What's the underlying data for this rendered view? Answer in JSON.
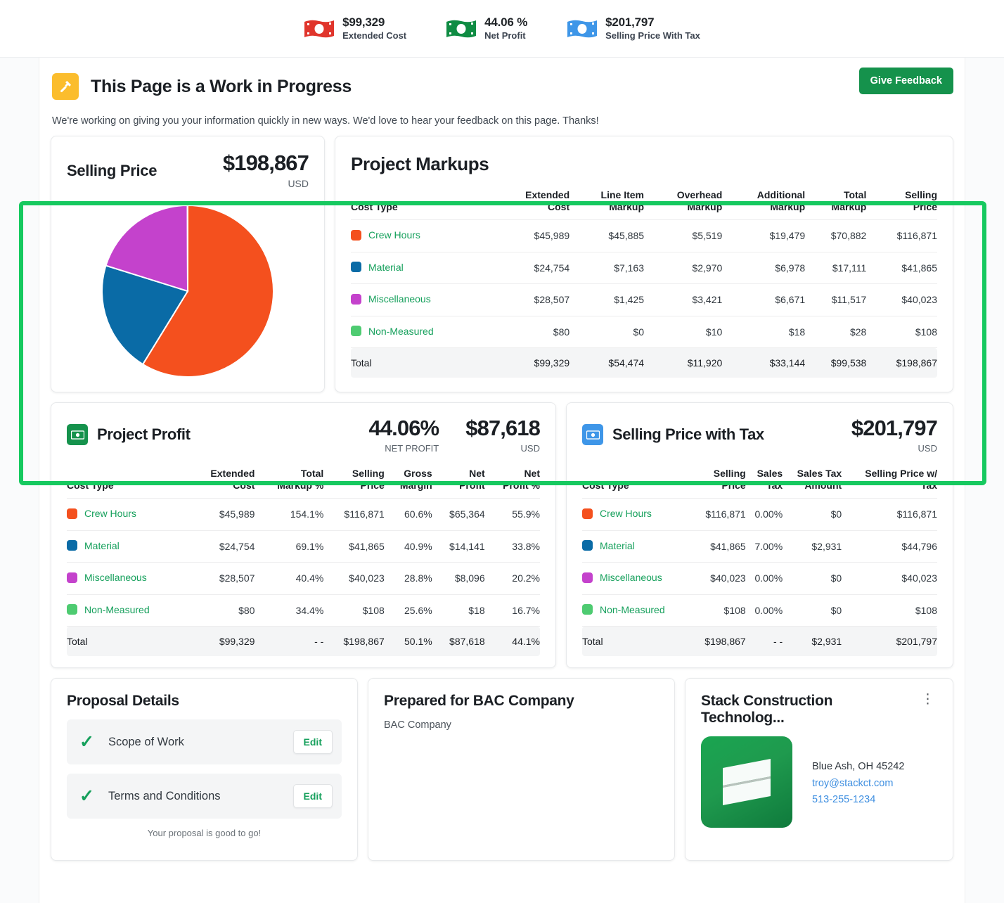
{
  "kpis": [
    {
      "icon": "money-bill-red-icon",
      "color": "#e0352c",
      "value": "$99,329",
      "label": "Extended Cost"
    },
    {
      "icon": "money-bill-green-icon",
      "color": "#0f8c43",
      "value": "44.06 %",
      "label": "Net Profit"
    },
    {
      "icon": "money-bill-blue-icon",
      "color": "#3e96e8",
      "value": "$201,797",
      "label": "Selling Price With Tax"
    }
  ],
  "banner": {
    "icon": "hammer-icon",
    "title": "This Page is a Work in Progress",
    "subtitle": "We're working on giving you your information quickly in new ways. We'd love to hear your feedback on this page. Thanks!",
    "button": "Give Feedback",
    "accent": "#15924c",
    "icon_bg": "#fbbd2d"
  },
  "highlight_color": "#16c95f",
  "selling_price": {
    "title": "Selling Price",
    "amount": "$198,867",
    "currency": "USD"
  },
  "chart_data": {
    "type": "pie",
    "title": "Selling Price",
    "categories": [
      "Crew Hours",
      "Material",
      "Miscellaneous",
      "Non-Measured"
    ],
    "values": [
      116871,
      41865,
      40023,
      108
    ],
    "percents": [
      58.77,
      21.05,
      20.13,
      0.05
    ],
    "colors": [
      "#f4501e",
      "#0a6ba6",
      "#c442cc",
      "#4ecb71"
    ],
    "total": 198867,
    "unit": "USD",
    "legend": "table",
    "grid": false
  },
  "markups": {
    "title": "Project Markups",
    "columns": [
      "Cost Type",
      "Extended\nCost",
      "Line Item\nMarkup",
      "Overhead\nMarkup",
      "Additional\nMarkup",
      "Total\nMarkup",
      "Selling\nPrice"
    ],
    "rows": [
      {
        "name": "Crew Hours",
        "color": "#f4501e",
        "cells": [
          "$45,989",
          "$45,885",
          "$5,519",
          "$19,479",
          "$70,882",
          "$116,871"
        ]
      },
      {
        "name": "Material",
        "color": "#0a6ba6",
        "cells": [
          "$24,754",
          "$7,163",
          "$2,970",
          "$6,978",
          "$17,111",
          "$41,865"
        ]
      },
      {
        "name": "Miscellaneous",
        "color": "#c442cc",
        "cells": [
          "$28,507",
          "$1,425",
          "$3,421",
          "$6,671",
          "$11,517",
          "$40,023"
        ]
      },
      {
        "name": "Non-Measured",
        "color": "#4ecb71",
        "cells": [
          "$80",
          "$0",
          "$10",
          "$18",
          "$28",
          "$108"
        ]
      }
    ],
    "total": {
      "name": "Total",
      "cells": [
        "$99,329",
        "$54,474",
        "$11,920",
        "$33,144",
        "$99,538",
        "$198,867"
      ]
    }
  },
  "profit": {
    "icon": "money-bill-green-square-icon",
    "icon_bg": "#15924c",
    "title": "Project Profit",
    "metrics": [
      {
        "value": "44.06%",
        "label": "NET PROFIT"
      },
      {
        "value": "$87,618",
        "label": "USD"
      }
    ],
    "columns": [
      "Cost Type",
      "Extended\nCost",
      "Total\nMarkup %",
      "Selling\nPrice",
      "Gross\nMargin",
      "Net\nProfit",
      "Net\nProfit %"
    ],
    "rows": [
      {
        "name": "Crew Hours",
        "color": "#f4501e",
        "cells": [
          "$45,989",
          "154.1%",
          "$116,871",
          "60.6%",
          "$65,364",
          "55.9%"
        ]
      },
      {
        "name": "Material",
        "color": "#0a6ba6",
        "cells": [
          "$24,754",
          "69.1%",
          "$41,865",
          "40.9%",
          "$14,141",
          "33.8%"
        ]
      },
      {
        "name": "Miscellaneous",
        "color": "#c442cc",
        "cells": [
          "$28,507",
          "40.4%",
          "$40,023",
          "28.8%",
          "$8,096",
          "20.2%"
        ]
      },
      {
        "name": "Non-Measured",
        "color": "#4ecb71",
        "cells": [
          "$80",
          "34.4%",
          "$108",
          "25.6%",
          "$18",
          "16.7%"
        ]
      }
    ],
    "total": {
      "name": "Total",
      "cells": [
        "$99,329",
        "- -",
        "$198,867",
        "50.1%",
        "$87,618",
        "44.1%"
      ]
    }
  },
  "tax": {
    "icon": "money-bill-blue-square-icon",
    "icon_bg": "#3e96e8",
    "title": "Selling Price with Tax",
    "metrics": [
      {
        "value": "$201,797",
        "label": "USD"
      }
    ],
    "columns": [
      "Cost Type",
      "Selling\nPrice",
      "Sales\nTax",
      "Sales Tax\nAmount",
      "Selling Price w/\nTax"
    ],
    "rows": [
      {
        "name": "Crew Hours",
        "color": "#f4501e",
        "cells": [
          "$116,871",
          "0.00%",
          "$0",
          "$116,871"
        ]
      },
      {
        "name": "Material",
        "color": "#0a6ba6",
        "cells": [
          "$41,865",
          "7.00%",
          "$2,931",
          "$44,796"
        ]
      },
      {
        "name": "Miscellaneous",
        "color": "#c442cc",
        "cells": [
          "$40,023",
          "0.00%",
          "$0",
          "$40,023"
        ]
      },
      {
        "name": "Non-Measured",
        "color": "#4ecb71",
        "cells": [
          "$108",
          "0.00%",
          "$0",
          "$108"
        ]
      }
    ],
    "total": {
      "name": "Total",
      "cells": [
        "$198,867",
        "- -",
        "$2,931",
        "$201,797"
      ]
    }
  },
  "proposal": {
    "title": "Proposal Details",
    "items": [
      {
        "label": "Scope of Work",
        "status_icon": "check-icon",
        "action": "Edit"
      },
      {
        "label": "Terms and Conditions",
        "status_icon": "check-icon",
        "action": "Edit"
      }
    ],
    "note": "Your proposal is good to go!"
  },
  "prepared": {
    "title": "Prepared for BAC Company",
    "customer": "BAC Company"
  },
  "company": {
    "title": "Stack Construction Technolog...",
    "menu_icon": "kebab-menu-icon",
    "logo_icon": "stack-logo-icon",
    "address": "Blue Ash, OH 45242",
    "email": "troy@stackct.com",
    "phone": "513-255-1234"
  }
}
